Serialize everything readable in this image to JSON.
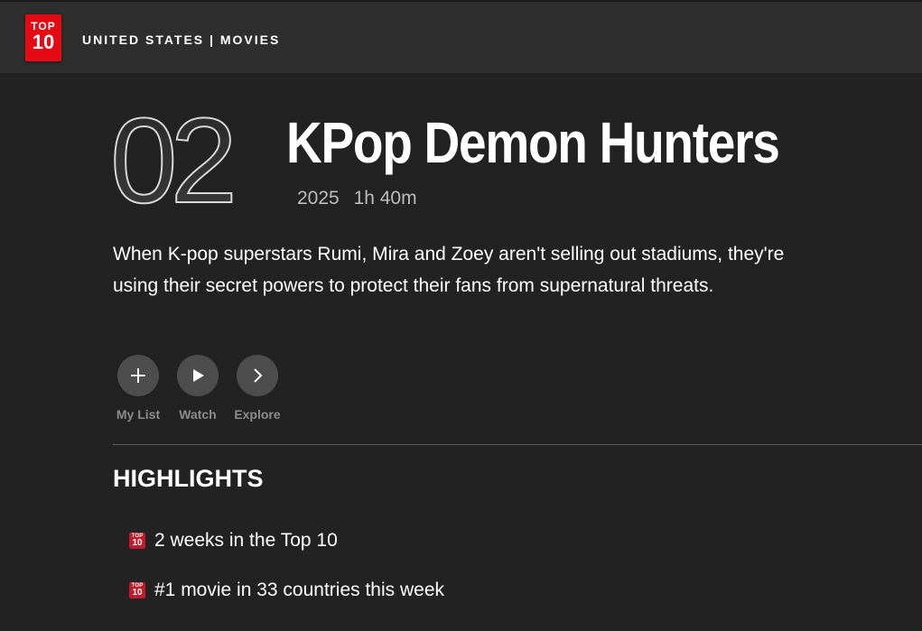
{
  "header": {
    "logo_top": "TOP",
    "logo_bottom": "10",
    "breadcrumb": "UNITED STATES | MOVIES"
  },
  "title": {
    "rank": "02",
    "name": "KPop Demon Hunters",
    "year": "2025",
    "duration": "1h 40m",
    "synopsis": "When K-pop superstars Rumi, Mira and Zoey aren't selling out stadiums, they're using their secret powers to protect their fans from supernatural threats."
  },
  "actions": {
    "my_list": {
      "label": "My List",
      "icon": "plus-icon"
    },
    "watch": {
      "label": "Watch",
      "icon": "play-icon"
    },
    "explore": {
      "label": "Explore",
      "icon": "chevron-right-icon"
    }
  },
  "highlights": {
    "heading": "HIGHLIGHTS",
    "badge_top": "TOP",
    "badge_bottom": "10",
    "items": [
      {
        "text": "2 weeks in the Top 10"
      },
      {
        "text": "#1 movie in 33 countries this week"
      }
    ]
  },
  "colors": {
    "background": "#222222",
    "header_bg": "#2e2e2e",
    "brand_red": "#e50914",
    "button_bg": "#4d4d4d",
    "muted_text": "#8c8c8c"
  }
}
